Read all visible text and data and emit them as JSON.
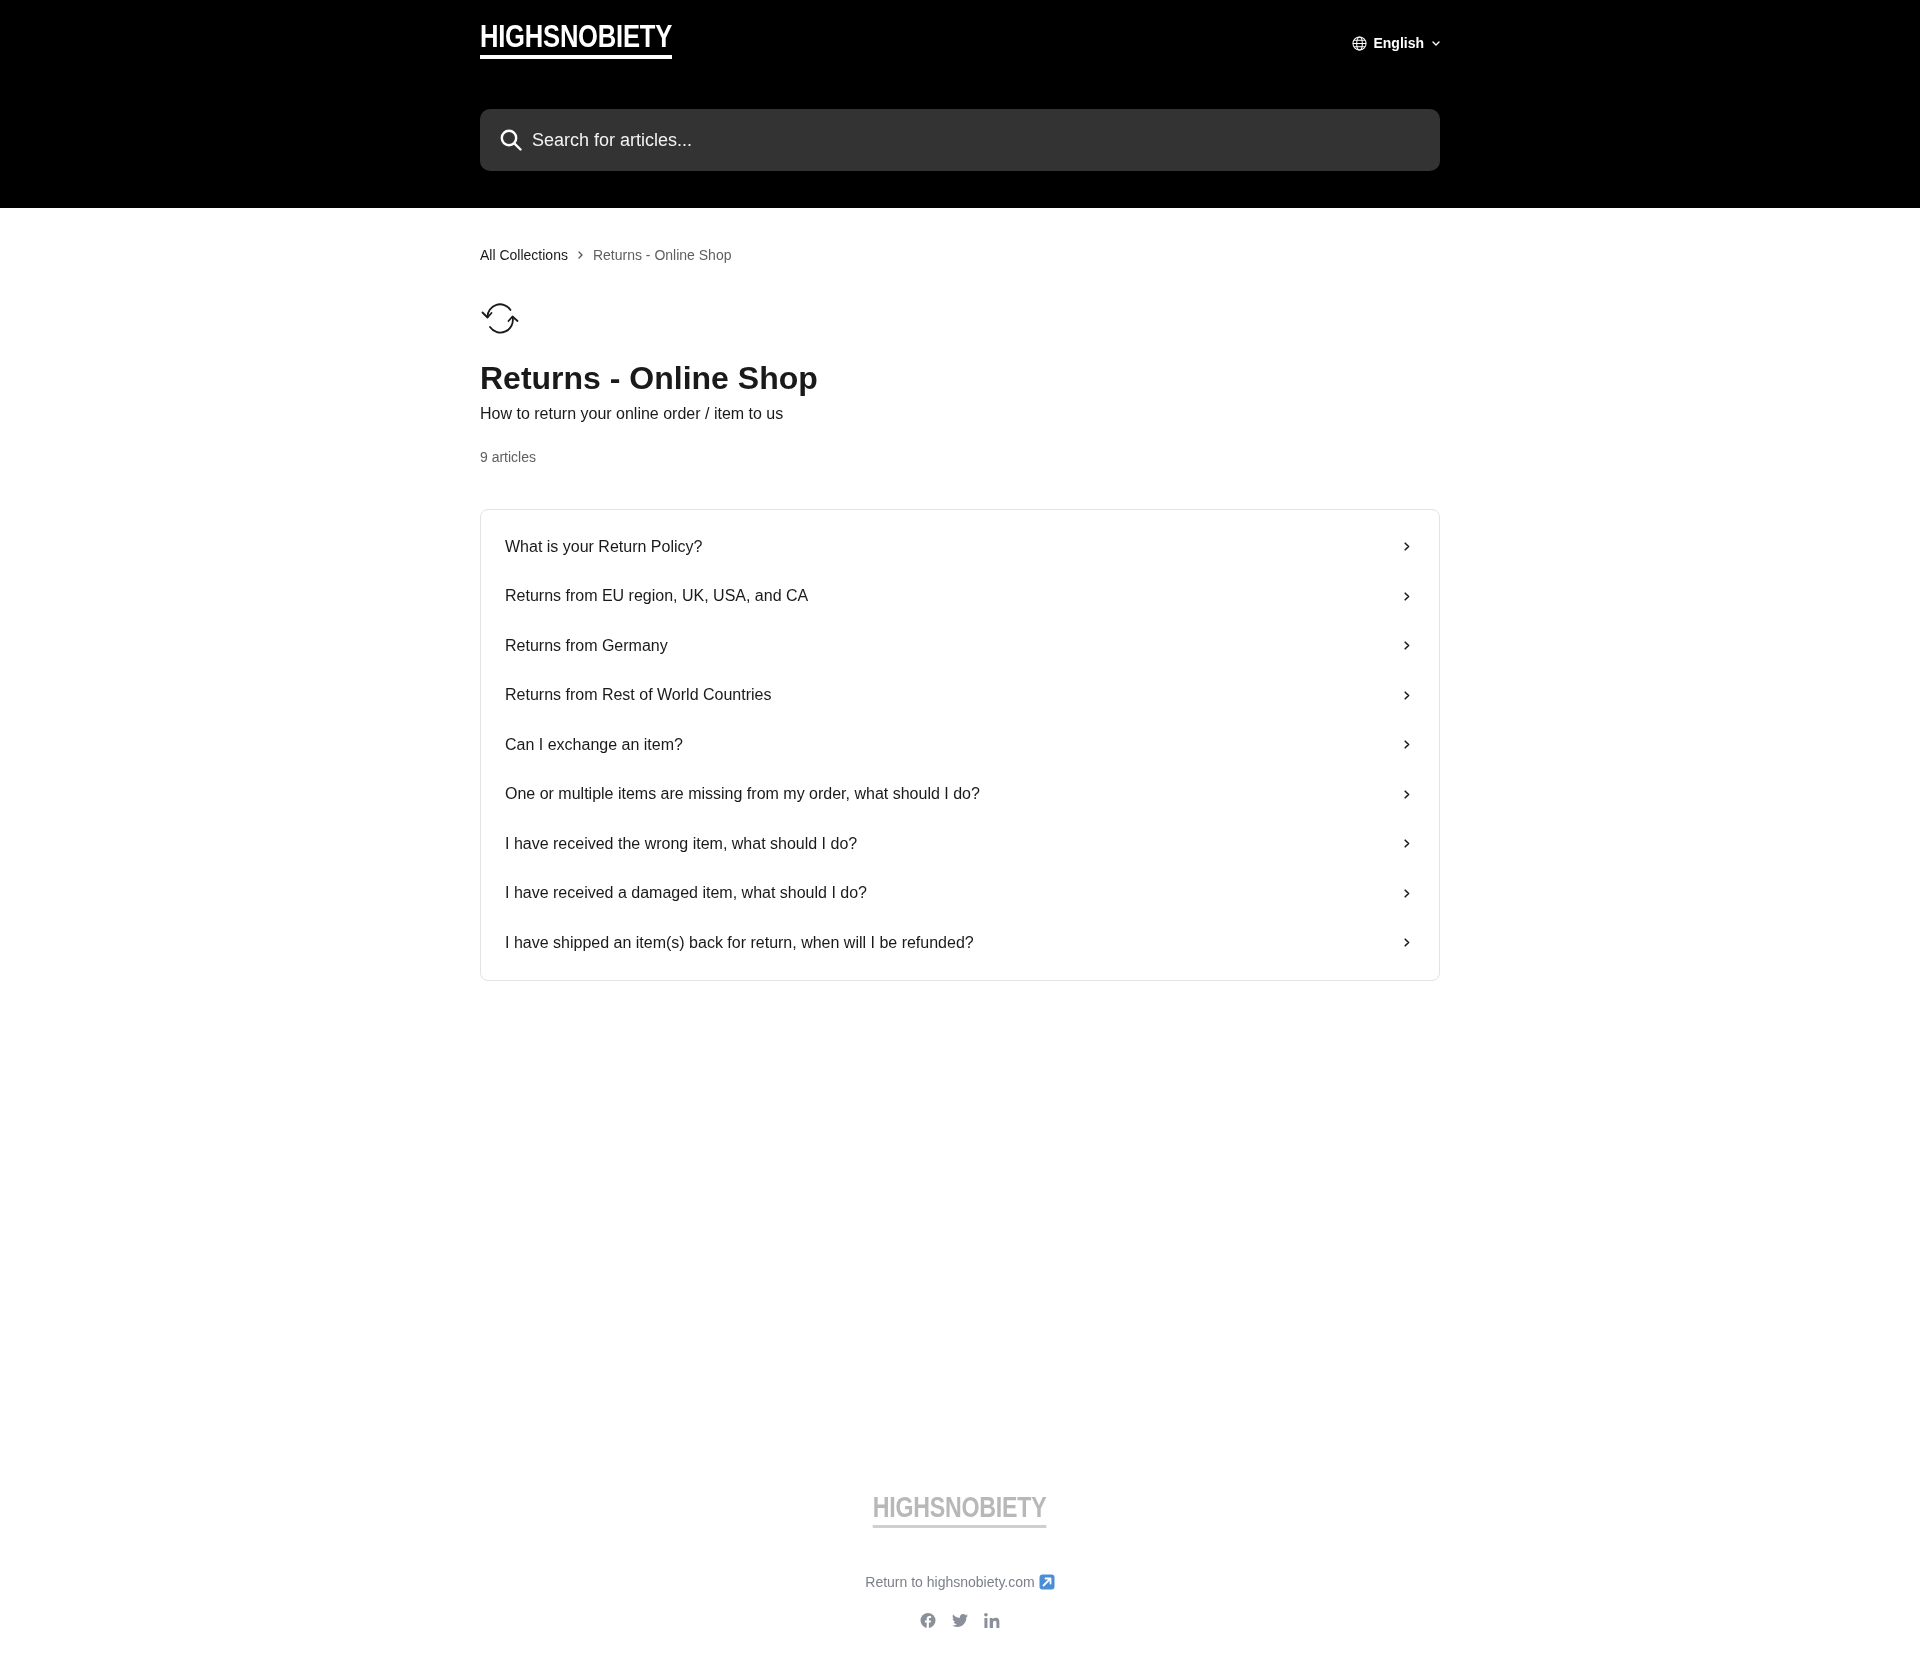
{
  "header": {
    "logo": "HIGHSNOBIETY",
    "language": "English",
    "search": {
      "placeholder": "Search for articles..."
    }
  },
  "breadcrumb": [
    {
      "label": "All Collections",
      "current": false
    },
    {
      "label": "Returns - Online Shop",
      "current": true
    }
  ],
  "collection": {
    "title": "Returns - Online Shop",
    "description": "How to return your online order / item to us",
    "article_count": "9 articles"
  },
  "articles": [
    {
      "title": "What is your Return Policy?"
    },
    {
      "title": "Returns from EU region, UK, USA, and CA"
    },
    {
      "title": "Returns from Germany"
    },
    {
      "title": "Returns from Rest of World Countries"
    },
    {
      "title": "Can I exchange an item?"
    },
    {
      "title": "One or multiple items are missing from my order, what should I do?"
    },
    {
      "title": "I have received the wrong item, what should I do?"
    },
    {
      "title": "I have received a damaged item, what should I do?"
    },
    {
      "title": "I have shipped an item(s) back for return, when will I be refunded?"
    }
  ],
  "footer": {
    "logo": "HIGHSNOBIETY",
    "link": "Return to highsnobiety.com"
  }
}
